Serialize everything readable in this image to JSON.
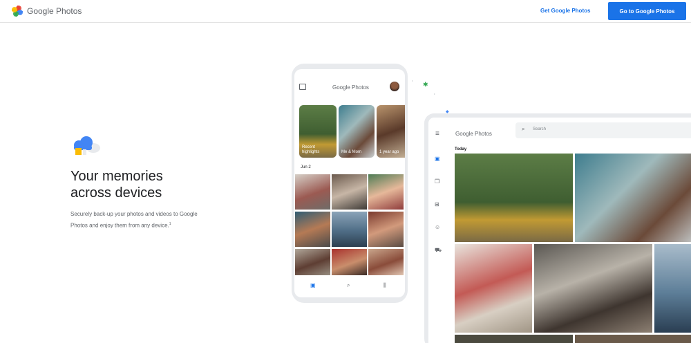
{
  "header": {
    "logo_text": "Google Photos",
    "get_link": "Get Google Photos",
    "go_button": "Go to Google Photos"
  },
  "hero": {
    "title_line1": "Your memories",
    "title_line2": "across devices",
    "description": "Securely back-up your photos and videos to Google Photos and enjoy them from any device.",
    "footnote": "1"
  },
  "phone": {
    "app_logo": "Google Photos",
    "highlights": [
      {
        "label_line1": "Recent",
        "label_line2": "highlights"
      },
      {
        "label_line1": "Me & Mom",
        "label_line2": ""
      },
      {
        "label_line1": "1 year ago",
        "label_line2": ""
      }
    ],
    "date_label": "Jun 2",
    "nav_icons": [
      "photos-icon",
      "search-icon",
      "library-icon"
    ]
  },
  "tablet": {
    "app_logo": "Google Photos",
    "search_placeholder": "Search",
    "section_label": "Today",
    "sidebar_icons": [
      "photos-icon",
      "albums-icon",
      "assistant-icon",
      "sharing-icon",
      "print-store-icon"
    ]
  },
  "colors": {
    "accent": "#1a73e8",
    "google_blue": "#4285f4",
    "google_red": "#ea4335",
    "google_yellow": "#fbbc04",
    "google_green": "#34a853"
  }
}
